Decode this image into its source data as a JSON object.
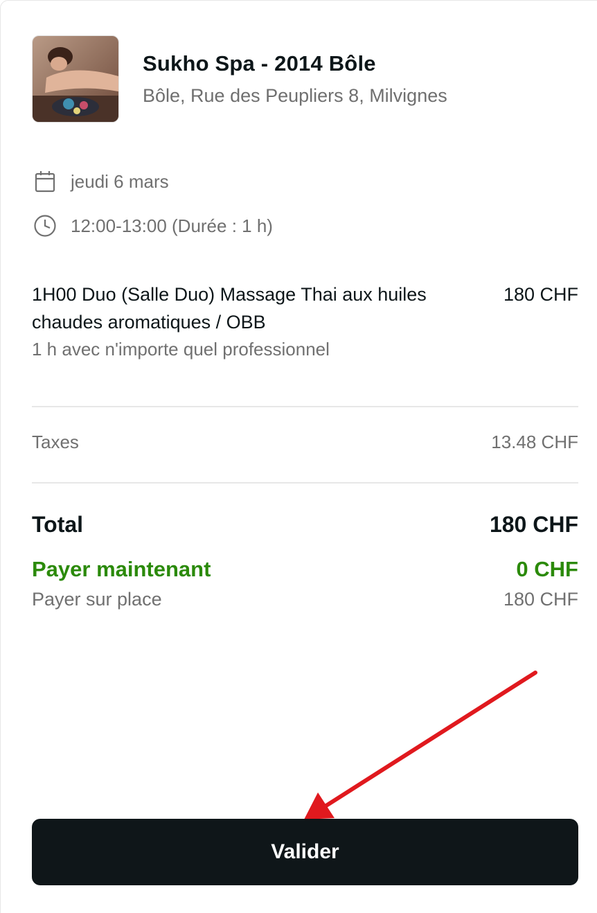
{
  "venue": {
    "name": "Sukho Spa - 2014 Bôle",
    "address": "Bôle, Rue des Peupliers 8, Milvignes"
  },
  "appointment": {
    "date": "jeudi 6 mars",
    "time": "12:00-13:00 (Durée : 1 h)"
  },
  "service": {
    "name": "1H00 Duo (Salle Duo) Massage Thai aux huiles chaudes aromatiques / OBB",
    "price": "180 CHF",
    "detail": "1 h avec n'importe quel professionnel"
  },
  "summary": {
    "taxes_label": "Taxes",
    "taxes_value": "13.48 CHF",
    "total_label": "Total",
    "total_value": "180 CHF",
    "pay_now_label": "Payer maintenant",
    "pay_now_value": "0 CHF",
    "pay_on_site_label": "Payer sur place",
    "pay_on_site_value": "180 CHF"
  },
  "actions": {
    "validate_label": "Valider"
  },
  "colors": {
    "pay_now": "#2b8a0a",
    "button_bg": "#0f1619",
    "annotation_arrow": "#e0191e"
  },
  "icons": {
    "date": "calendar-icon",
    "time": "clock-icon"
  }
}
